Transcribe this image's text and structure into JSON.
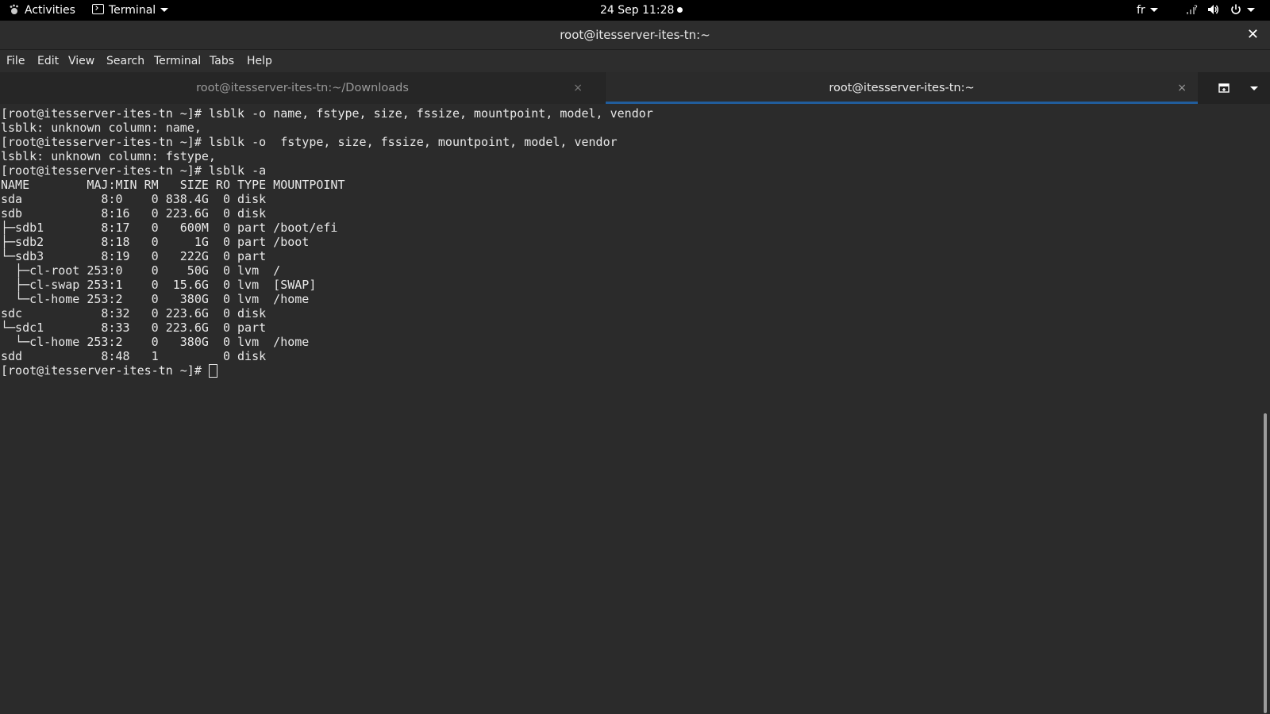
{
  "topbar": {
    "activities": "Activities",
    "app_name": "Terminal",
    "clock": "24 Sep  11:28",
    "keyboard_layout": "fr"
  },
  "window": {
    "title": "root@itesserver-ites-tn:~",
    "close": "✕"
  },
  "menu": [
    "File",
    "Edit",
    "View",
    "Search",
    "Terminal",
    "Tabs",
    "Help"
  ],
  "tabs": [
    {
      "title": "root@itesserver-ites-tn:~/Downloads",
      "active": false,
      "close": "×"
    },
    {
      "title": "root@itesserver-ites-tn:~",
      "active": true,
      "close": "×"
    }
  ],
  "terminal": {
    "lines": [
      "[root@itesserver-ites-tn ~]# lsblk -o name, fstype, size, fssize, mountpoint, model, vendor",
      "lsblk: unknown column: name,",
      "[root@itesserver-ites-tn ~]# lsblk -o  fstype, size, fssize, mountpoint, model, vendor",
      "lsblk: unknown column: fstype,",
      "[root@itesserver-ites-tn ~]# lsblk -a",
      "NAME        MAJ:MIN RM   SIZE RO TYPE MOUNTPOINT",
      "sda           8:0    0 838.4G  0 disk",
      "sdb           8:16   0 223.6G  0 disk",
      "├─sdb1        8:17   0   600M  0 part /boot/efi",
      "├─sdb2        8:18   0     1G  0 part /boot",
      "└─sdb3        8:19   0   222G  0 part",
      "  ├─cl-root 253:0    0    50G  0 lvm  /",
      "  ├─cl-swap 253:1    0  15.6G  0 lvm  [SWAP]",
      "  └─cl-home 253:2    0   380G  0 lvm  /home",
      "sdc           8:32   0 223.6G  0 disk",
      "└─sdc1        8:33   0 223.6G  0 part",
      "  └─cl-home 253:2    0   380G  0 lvm  /home",
      "sdd           8:48   1         0 disk"
    ],
    "prompt": "[root@itesserver-ites-tn ~]# "
  },
  "colors": {
    "terminal_bg": "#2b2b2b",
    "terminal_fg": "#e8e8e8",
    "active_tab_accent": "#215d9c"
  }
}
